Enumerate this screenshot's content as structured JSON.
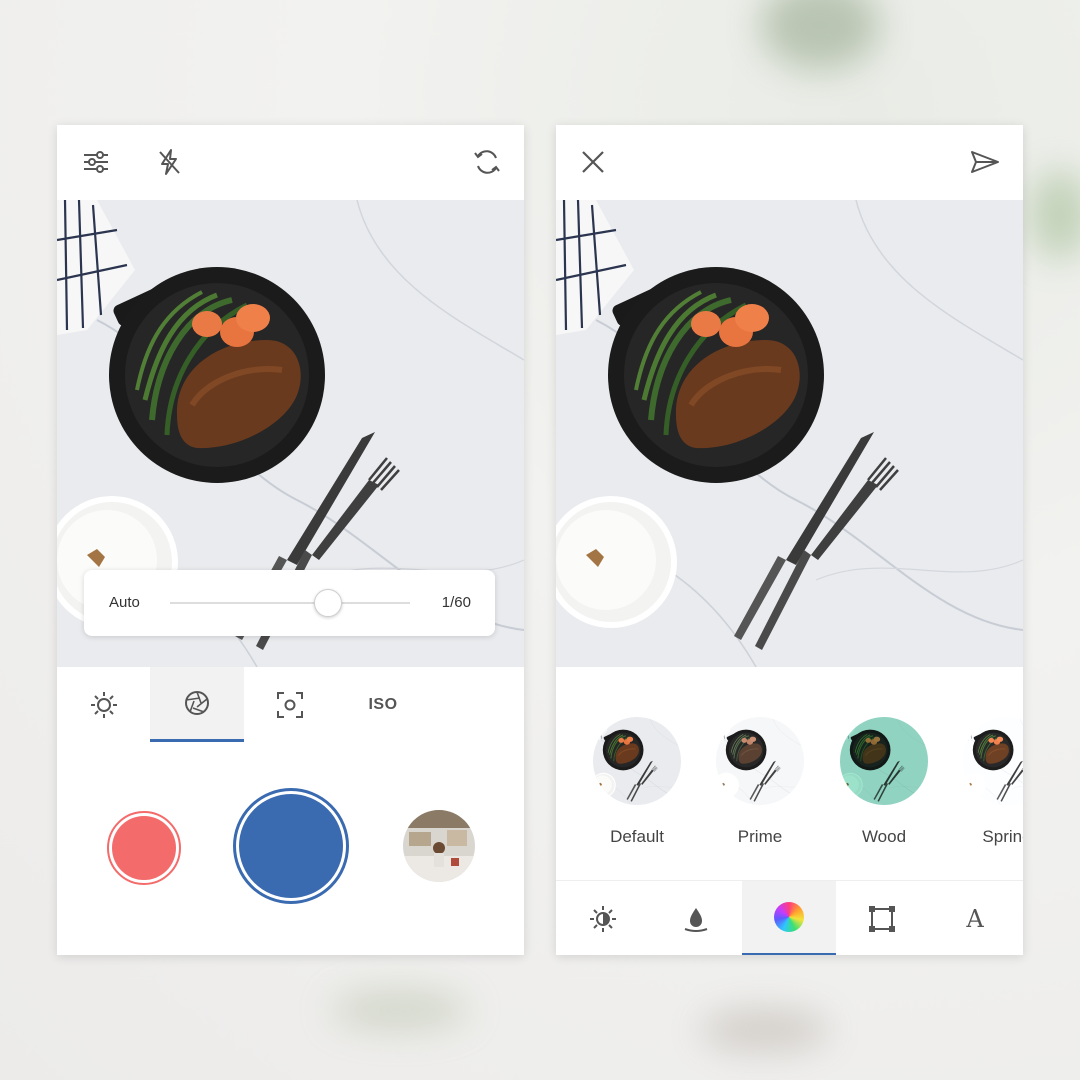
{
  "colors": {
    "accent_blue": "#3a6ab0",
    "record_red": "#f36b6b",
    "active_tab_bg": "#f2f2f2"
  },
  "left_screen": {
    "toolbar_icons": [
      "sliders-icon",
      "flash-off-icon",
      "switch-camera-icon"
    ],
    "shutter_speed": {
      "mode_label": "Auto",
      "value_label": "1/60",
      "slider_level": 0.66
    },
    "mode_tabs": [
      {
        "icon": "brightness-icon",
        "label": "",
        "active": false
      },
      {
        "icon": "aperture-icon",
        "label": "",
        "active": true
      },
      {
        "icon": "focus-icon",
        "label": "",
        "active": false
      },
      {
        "icon": "",
        "label": "ISO",
        "active": false
      }
    ],
    "buttons": [
      "record-button",
      "shutter-button",
      "gallery-thumbnail"
    ]
  },
  "right_screen": {
    "toolbar_icons": [
      "close-icon",
      "send-icon"
    ],
    "filters": [
      {
        "label": "Default"
      },
      {
        "label": "Prime"
      },
      {
        "label": "Wood"
      },
      {
        "label": "Spring"
      }
    ],
    "edit_tabs": [
      {
        "icon": "exposure-icon",
        "active": false
      },
      {
        "icon": "drop-icon",
        "active": false
      },
      {
        "icon": "color-wheel-icon",
        "active": true
      },
      {
        "icon": "crop-icon",
        "active": false
      },
      {
        "icon": "text-icon",
        "label": "A",
        "active": false
      }
    ]
  }
}
